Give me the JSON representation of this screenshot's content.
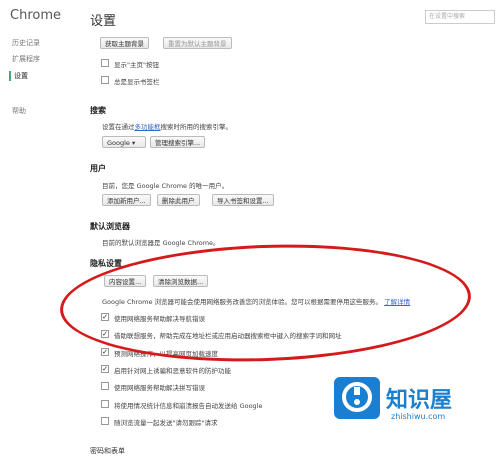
{
  "sidebar": {
    "title": "Chrome",
    "items": [
      {
        "label": "历史记录"
      },
      {
        "label": "扩展程序"
      },
      {
        "label": "设置"
      },
      {
        "label": "帮助"
      }
    ]
  },
  "main": {
    "title": "设置",
    "search_placeholder": "在设置中搜索"
  },
  "appearance": {
    "get_theme": "获取主题背景",
    "reset_theme": "重置为默认主题背景",
    "show_home": "显示\"主页\"按钮",
    "show_bookmarks": "总是显示书签栏"
  },
  "search": {
    "heading": "搜索",
    "desc_pre": "设置在通过",
    "desc_link": "多功能框",
    "desc_post": "搜索时所用的搜索引擎。",
    "engine": "Google",
    "manage": "管理搜索引擎..."
  },
  "users": {
    "heading": "用户",
    "desc": "目前，您是 Google Chrome 的唯一用户。",
    "add": "添加新用户...",
    "remove": "删除此用户",
    "import": "导入书签和设置..."
  },
  "default_browser": {
    "heading": "默认浏览器",
    "desc": "目前的默认浏览器是 Google Chrome。"
  },
  "privacy": {
    "heading": "隐私设置",
    "content_settings": "内容设置...",
    "clear_data": "清除浏览数据...",
    "desc": "Google Chrome 浏览器可能会使用网络服务改善您的浏览体验。您可以根据需要停用这些服务。",
    "learn_more": "了解详情",
    "options": [
      {
        "label": "使用网络服务帮助解决导航错误",
        "checked": "✓"
      },
      {
        "label": "借助联想服务，帮助完成在地址栏或应用启动器搜索框中键入的搜索字词和网址",
        "checked": "✓"
      },
      {
        "label": "预测网络操作，以提高网页加载速度",
        "checked": "✓"
      },
      {
        "label": "启用针对网上诱骗和恶意软件的防护功能",
        "checked": "✓"
      },
      {
        "label": "使用网络服务帮助解决拼写错误",
        "checked": ""
      },
      {
        "label": "将使用情况统计信息和崩溃报告自动发送给 Google",
        "checked": ""
      },
      {
        "label": "随浏览流量一起发送\"请勿跟踪\"请求",
        "checked": ""
      }
    ]
  },
  "passwords": {
    "heading": "密码和表单"
  },
  "watermark": {
    "brand": "知识屋",
    "url": "zhishiwu.com"
  },
  "colors": {
    "annotation": "#d41a1a",
    "link": "#3366cc",
    "brand": "#1a7fd0"
  }
}
